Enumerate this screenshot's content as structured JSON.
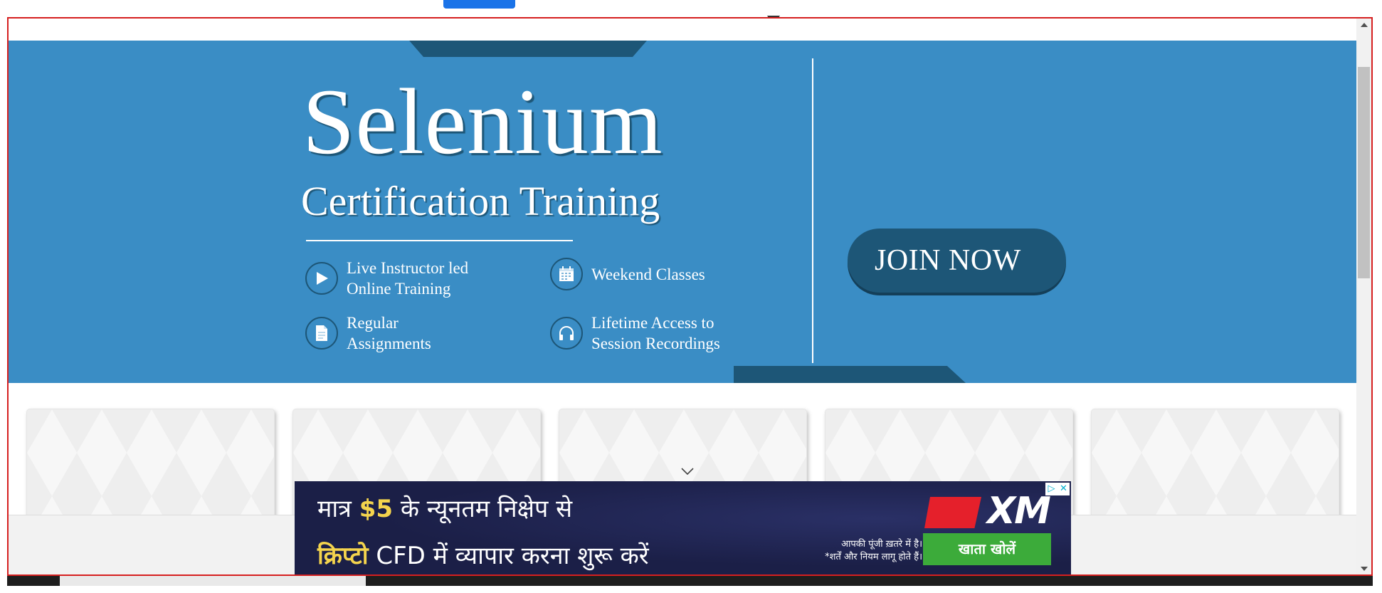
{
  "banner": {
    "title": "Selenium",
    "subtitle": "Certification Training",
    "features": [
      {
        "icon": "play-icon",
        "label_line1": "Live Instructor led",
        "label_line2": "Online Training"
      },
      {
        "icon": "calendar-icon",
        "label_line1": "Weekend Classes",
        "label_line2": ""
      },
      {
        "icon": "document-icon",
        "label_line1": "Regular",
        "label_line2": "Assignments"
      },
      {
        "icon": "headphones-icon",
        "label_line1": "Lifetime Access to",
        "label_line2": "Session Recordings"
      }
    ],
    "cta_label": "JOIN NOW",
    "colors": {
      "background": "#3a8dc5",
      "accent": "#1d5677",
      "text": "#ffffff"
    }
  },
  "cards": {
    "count": 5
  },
  "ad": {
    "line1_pre": "मात्र ",
    "line1_highlight": "$5",
    "line1_post": " के न्यूनतम निक्षेप से",
    "line2_highlight": "क्रिप्टो",
    "line2_post": " CFD में  व्यापार करना शुरू करें",
    "brand": "XM",
    "risk_line1": "आपकी पूंजी ख़तरे में है।",
    "risk_line2": "*शर्तें और नियम लागू होते हैं।",
    "cta_label": "खाता खोलें",
    "choices_icon": "ad-choices-icon",
    "close_icon": "close-icon",
    "colors": {
      "background": "#1b1f47",
      "highlight": "#f4d44d",
      "cta": "#3cab3a",
      "brand_red": "#e5202b"
    }
  },
  "frame": {
    "border_color": "#d61f1f"
  }
}
